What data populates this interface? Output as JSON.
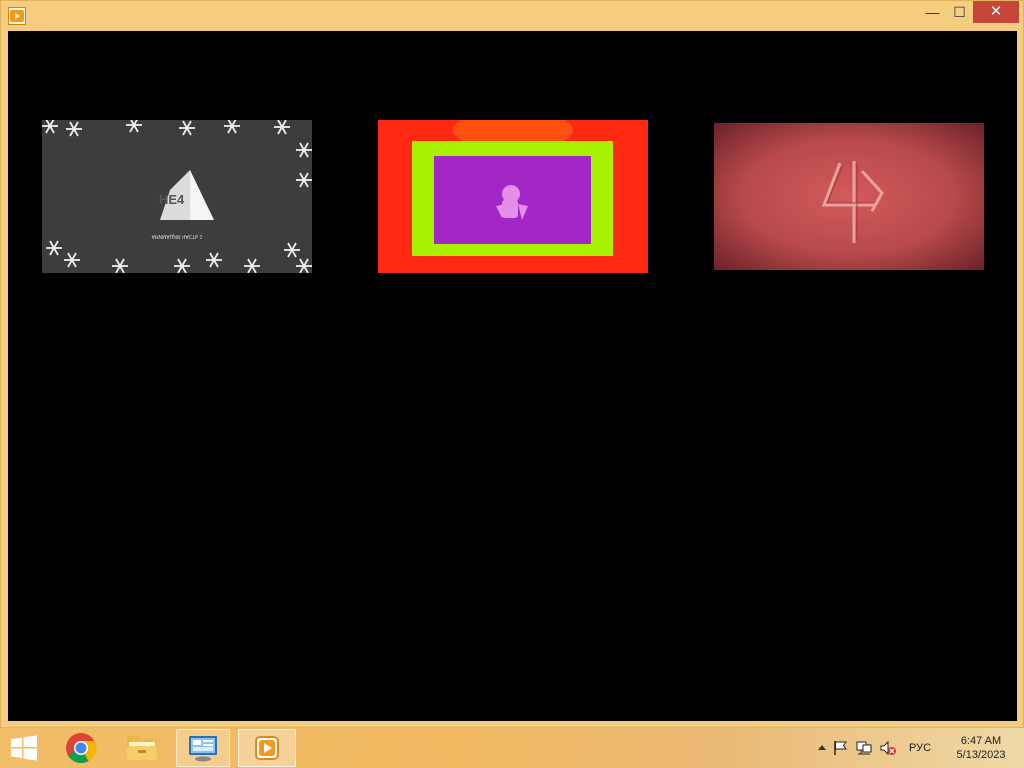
{
  "window": {
    "title": "",
    "controls": {
      "minimize": "—",
      "maximize": "☐",
      "close": "✕"
    }
  },
  "colors": {
    "frame": "#f5cd7e",
    "close_button": "#c7463a",
    "client_background": "#000000"
  },
  "thumbnails": [
    {
      "id": "thumb-1",
      "logo_text": "НЕ4",
      "caption": "АНИМАЦИЯ ЧАСТЬ 1",
      "theme": "grayscale snowflakes"
    },
    {
      "id": "thumb-2",
      "theme": "red / lime / purple frames"
    },
    {
      "id": "thumb-3",
      "theme": "red background, woven 4 logo"
    }
  ],
  "taskbar": {
    "items": [
      {
        "name": "start-button",
        "icon": "windows-logo-icon"
      },
      {
        "name": "chrome",
        "icon": "chrome-icon"
      },
      {
        "name": "file-explorer",
        "icon": "folder-icon"
      },
      {
        "name": "remote-desktop",
        "icon": "remote-desktop-icon"
      },
      {
        "name": "media-player",
        "icon": "play-icon"
      }
    ],
    "tray": {
      "language": "РУС",
      "time": "6:47 AM",
      "date": "5/13/2023"
    }
  }
}
